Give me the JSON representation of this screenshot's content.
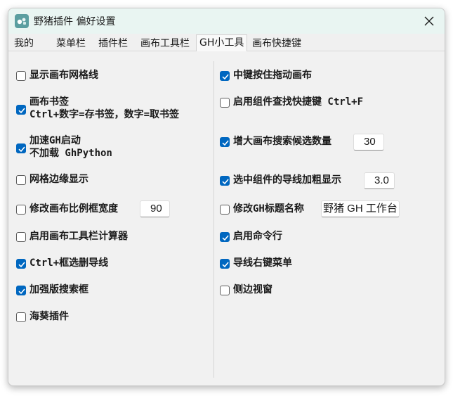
{
  "window": {
    "title": "野猪插件 偏好设置"
  },
  "tabs": [
    {
      "label": "我的",
      "active": false
    },
    {
      "label": "菜单栏",
      "active": false
    },
    {
      "label": "插件栏",
      "active": false
    },
    {
      "label": "画布工具栏",
      "active": false
    },
    {
      "label": "GH小工具",
      "active": true
    },
    {
      "label": "画布快捷键",
      "active": false
    }
  ],
  "left_options": [
    {
      "label": "显示画布网格线",
      "checked": false
    },
    {
      "label": "画布书签",
      "label2": "Ctrl+数字=存书签，数字=取书签",
      "checked": true
    },
    {
      "label": "加速GH启动",
      "label2": "不加载 GhPython",
      "checked": true
    },
    {
      "label": "网格边缘显示",
      "checked": false
    },
    {
      "label": "修改画布比例框宽度",
      "checked": false,
      "value": "90"
    },
    {
      "label": "启用画布工具栏计算器",
      "checked": false
    },
    {
      "label": "Ctrl+框选删导线",
      "checked": true
    },
    {
      "label": "加强版搜索框",
      "checked": true
    },
    {
      "label": "海葵插件",
      "checked": false
    }
  ],
  "right_options": [
    {
      "label": "中键按住拖动画布",
      "checked": true
    },
    {
      "label": "启用组件查找快捷键 Ctrl+F",
      "checked": false
    },
    {
      "label": "增大画布搜索候选数量",
      "checked": true,
      "value": "30"
    },
    {
      "label": "选中组件的导线加粗显示",
      "checked": true,
      "value": "3.0"
    },
    {
      "label": "修改GH标题名称",
      "checked": false,
      "value": "野猪 GH 工作台"
    },
    {
      "label": "启用命令行",
      "checked": true
    },
    {
      "label": "导线右键菜单",
      "checked": true
    },
    {
      "label": "侧边视窗",
      "checked": false
    }
  ],
  "colors": {
    "accent": "#0067c0",
    "titlebar": "#e9f5f2",
    "background": "#f1f1f1"
  },
  "icons": {
    "app": "grasshopper-plugin-icon",
    "close": "close-icon",
    "check": "checkmark-icon"
  }
}
